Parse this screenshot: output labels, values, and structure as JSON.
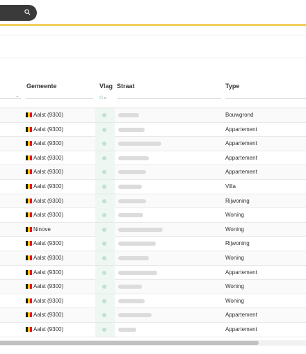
{
  "search": {
    "icon": "search-icon",
    "bar_color": "#3a3a3a",
    "accent": "#f0c230"
  },
  "table": {
    "headers": {
      "gemeente": "Gemeente",
      "vlag": "Vlag",
      "straat": "Straat",
      "type": "Type"
    },
    "rows": [
      {
        "gemeente": "Aalst (9300)",
        "type": "Bouwgrond"
      },
      {
        "gemeente": "Aalst (9300)",
        "type": "Appartement"
      },
      {
        "gemeente": "Aalst (9300)",
        "type": "Appartement"
      },
      {
        "gemeente": "Aalst (9300)",
        "type": "Appartement"
      },
      {
        "gemeente": "Aalst (9300)",
        "type": "Appartement"
      },
      {
        "gemeente": "Aalst (9300)",
        "type": "Villa"
      },
      {
        "gemeente": "Aalst (9300)",
        "type": "Rijwoning"
      },
      {
        "gemeente": "Aalst (9300)",
        "type": "Woning"
      },
      {
        "gemeente": "Ninove",
        "type": "Woning"
      },
      {
        "gemeente": "Aalst (9300)",
        "type": "Rijwoning"
      },
      {
        "gemeente": "Aalst (9300)",
        "type": "Woning"
      },
      {
        "gemeente": "Aalst (9300)",
        "type": "Appartement"
      },
      {
        "gemeente": "Aalst (9300)",
        "type": "Woning"
      },
      {
        "gemeente": "Aalst (9300)",
        "type": "Woning"
      },
      {
        "gemeente": "Aalst (9300)",
        "type": "Appartement"
      },
      {
        "gemeente": "Aalst (9300)",
        "type": "Appartement"
      }
    ]
  },
  "colors": {
    "flag_black": "#1a1a1a",
    "flag_yellow": "#f5d000",
    "flag_red": "#e8112d",
    "vlag_green": "#29a36b"
  }
}
